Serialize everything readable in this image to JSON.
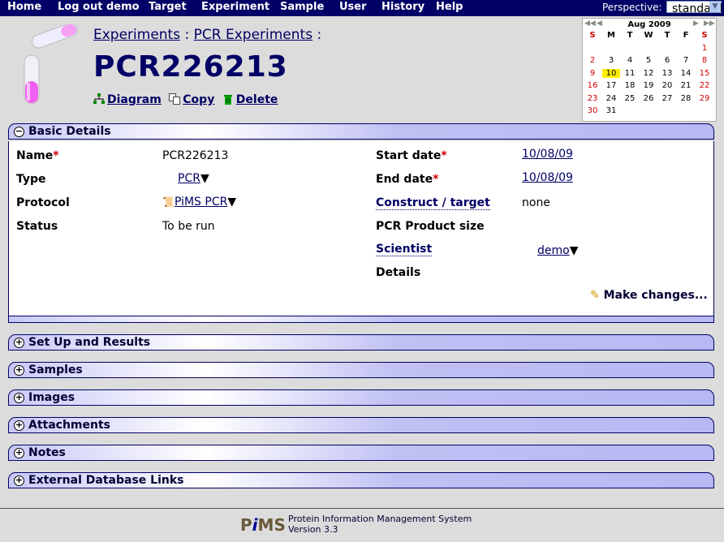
{
  "nav": {
    "items": [
      "Home",
      "Log out demo",
      "Target",
      "Experiment",
      "Sample",
      "User",
      "History",
      "Help"
    ],
    "perspective_label": "Perspective:",
    "perspective_value": "standard"
  },
  "breadcrumb": {
    "item1": "Experiments",
    "sep": ":",
    "item2": "PCR Experiments",
    "trail": ":"
  },
  "title": "PCR226213",
  "actions": {
    "diagram": "Diagram",
    "copy": "Copy",
    "delete": "Delete"
  },
  "calendar": {
    "month": "Aug 2009",
    "days_of_week": [
      "S",
      "M",
      "T",
      "W",
      "T",
      "F",
      "S"
    ],
    "today": 10
  },
  "basic_details": {
    "title": "Basic Details",
    "name_label": "Name",
    "name_value": "PCR226213",
    "type_label": "Type",
    "type_value": "PCR",
    "protocol_label": "Protocol",
    "protocol_value": "PiMS PCR",
    "status_label": "Status",
    "status_value": "To be run",
    "start_label": "Start date",
    "start_value": "10/08/09",
    "end_label": "End date",
    "end_value": "10/08/09",
    "construct_label": "Construct / target",
    "construct_value": "none",
    "product_label": "PCR Product size",
    "scientist_label": "Scientist",
    "scientist_value": "demo",
    "details_label": "Details",
    "make_changes": "Make changes..."
  },
  "sections": [
    "Set Up and Results",
    "Samples",
    "Images",
    "Attachments",
    "Notes",
    "External Database Links"
  ],
  "footer": {
    "logo": "PiMS",
    "line1": "Protein Information Management System",
    "line2": "Version 3.3"
  },
  "colors": {
    "nav_bg": "#000066",
    "accent": "#000066",
    "required": "#cc0000"
  }
}
